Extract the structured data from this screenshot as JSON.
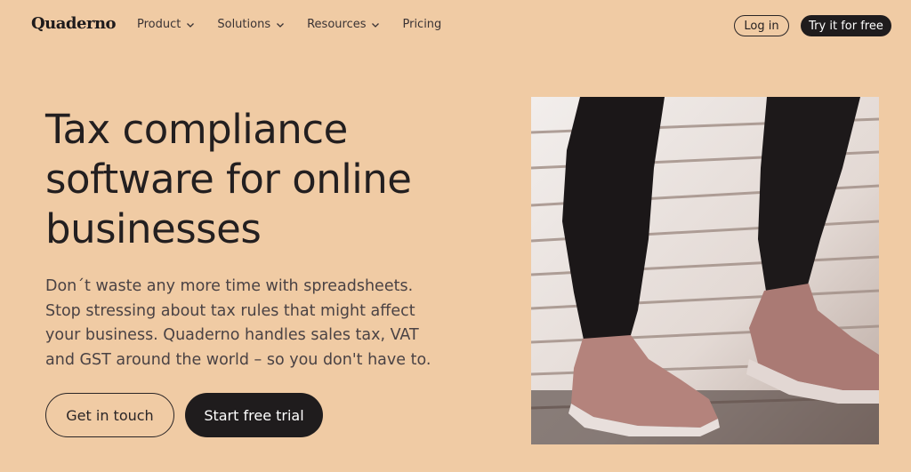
{
  "nav": {
    "logo": "Quaderno",
    "menu": [
      {
        "label": "Product",
        "has_dropdown": true
      },
      {
        "label": "Solutions",
        "has_dropdown": true
      },
      {
        "label": "Resources",
        "has_dropdown": true
      },
      {
        "label": "Pricing",
        "has_dropdown": false
      }
    ],
    "login_label": "Log in",
    "try_label": "Try it for free"
  },
  "hero": {
    "headline_lines": [
      "Tax compliance",
      "software for online",
      "businesses"
    ],
    "subtext": "Don´t waste any more time with spreadsheets. Stop stressing about tax rules that might affect your business. Quaderno handles sales tax, VAT and GST around the world – so you don't have to.",
    "primary_button": "Start free trial",
    "secondary_button": "Get in touch"
  },
  "colors": {
    "background": "#f0cba4",
    "dark": "#1f1c1d",
    "text": "#231f20"
  },
  "icons": {
    "dropdown": "chevron-down-icon"
  }
}
